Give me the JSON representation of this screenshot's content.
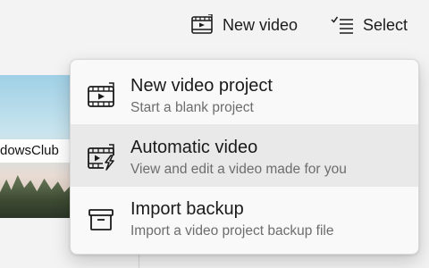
{
  "toolbar": {
    "new_video_label": "New video",
    "new_video_icon": "film-strip-icon",
    "select_label": "Select",
    "select_icon": "checklist-icon"
  },
  "background_card": {
    "label": "dowsClub"
  },
  "menu": {
    "items": [
      {
        "title": "New video project",
        "subtitle": "Start a blank project",
        "icon": "film-play-icon"
      },
      {
        "title": "Automatic video",
        "subtitle": "View and edit a video made for you",
        "icon": "film-lightning-icon",
        "highlighted": true
      },
      {
        "title": "Import backup",
        "subtitle": "Import a video project backup file",
        "icon": "archive-box-icon"
      }
    ]
  },
  "colors": {
    "background": "#f3f3f3",
    "menu_background": "#f9f9f9",
    "menu_hover": "#e9e9e9",
    "secondary_text": "#6d6d6d"
  }
}
